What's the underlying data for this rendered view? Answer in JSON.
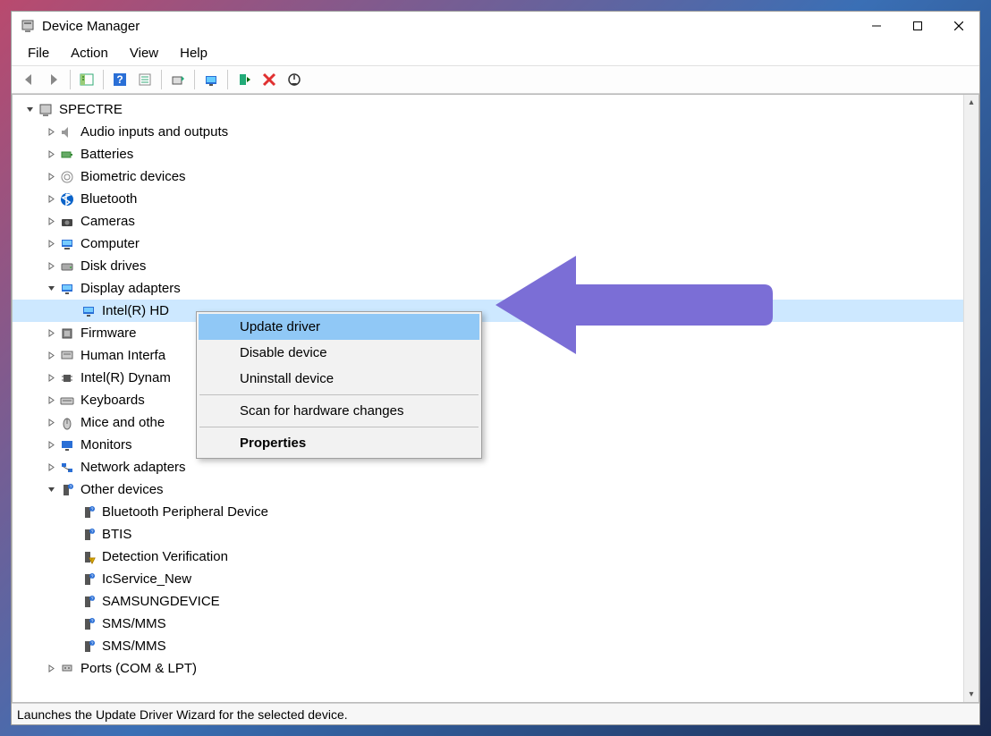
{
  "window": {
    "title": "Device Manager",
    "buttons": {
      "minimize": "–",
      "maximize": "☐",
      "close": "✕"
    }
  },
  "menubar": [
    "File",
    "Action",
    "View",
    "Help"
  ],
  "toolbar_icons": [
    "back-icon",
    "forward-icon",
    "show-hide-tree-icon",
    "help-icon",
    "properties-icon",
    "update-driver-icon",
    "scan-icon",
    "enable-icon",
    "disable-icon",
    "uninstall-icon"
  ],
  "root": "SPECTRE",
  "categories": [
    {
      "label": "Audio inputs and outputs",
      "icon": "speaker-icon",
      "exp": "›"
    },
    {
      "label": "Batteries",
      "icon": "battery-icon",
      "exp": "›"
    },
    {
      "label": "Biometric devices",
      "icon": "fingerprint-icon",
      "exp": "›"
    },
    {
      "label": "Bluetooth",
      "icon": "bluetooth-icon",
      "exp": "›"
    },
    {
      "label": "Cameras",
      "icon": "camera-icon",
      "exp": "›"
    },
    {
      "label": "Computer",
      "icon": "computer-icon",
      "exp": "›"
    },
    {
      "label": "Disk drives",
      "icon": "disk-icon",
      "exp": "›"
    },
    {
      "label": "Display adapters",
      "icon": "display-icon",
      "exp": "⌄",
      "children": [
        {
          "label": "Intel(R) HD",
          "icon": "display-icon",
          "selected": true
        }
      ]
    },
    {
      "label": "Firmware",
      "icon": "firmware-icon",
      "exp": "›"
    },
    {
      "label": "Human Interfa",
      "icon": "hid-icon",
      "exp": "›"
    },
    {
      "label": "Intel(R) Dynam",
      "icon": "chip-icon",
      "exp": "›"
    },
    {
      "label": "Keyboards",
      "icon": "keyboard-icon",
      "exp": "›"
    },
    {
      "label": "Mice and othe",
      "icon": "mouse-icon",
      "exp": "›"
    },
    {
      "label": "Monitors",
      "icon": "monitor-icon",
      "exp": "›"
    },
    {
      "label": "Network adapters",
      "icon": "network-icon",
      "exp": "›"
    },
    {
      "label": "Other devices",
      "icon": "other-icon",
      "exp": "⌄",
      "children": [
        {
          "label": "Bluetooth Peripheral Device",
          "icon": "unknown-icon"
        },
        {
          "label": "BTIS",
          "icon": "unknown-icon"
        },
        {
          "label": "Detection Verification",
          "icon": "unknown-warn-icon"
        },
        {
          "label": "IcService_New",
          "icon": "unknown-icon"
        },
        {
          "label": "SAMSUNGDEVICE",
          "icon": "unknown-icon"
        },
        {
          "label": "SMS/MMS",
          "icon": "unknown-icon"
        },
        {
          "label": "SMS/MMS",
          "icon": "unknown-icon"
        }
      ]
    },
    {
      "label": "Ports (COM & LPT)",
      "icon": "port-icon",
      "exp": "›"
    }
  ],
  "context_menu": {
    "items": [
      {
        "label": "Update driver",
        "hovered": true
      },
      {
        "label": "Disable device"
      },
      {
        "label": "Uninstall device"
      },
      {
        "sep": true
      },
      {
        "label": "Scan for hardware changes"
      },
      {
        "sep": true
      },
      {
        "label": "Properties",
        "bold": true
      }
    ]
  },
  "statusbar": "Launches the Update Driver Wizard for the selected device.",
  "arrow_color": "#7b6ed6"
}
